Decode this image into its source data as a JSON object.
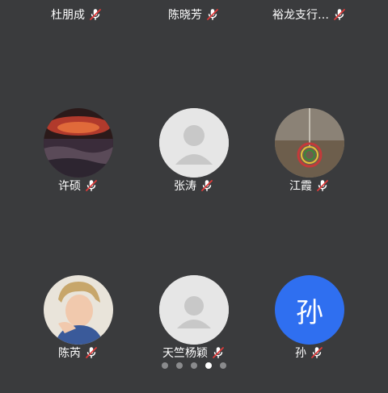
{
  "participants": [
    {
      "name": "杜朋成",
      "avatar_type": "blue-partial",
      "mic": "muted-mic-icon"
    },
    {
      "name": "陈晓芳",
      "avatar_type": "blue-partial",
      "mic": "muted-mic-icon"
    },
    {
      "name": "裕龙支行…",
      "avatar_type": "photo-partial",
      "mic": "muted-mic-icon"
    },
    {
      "name": "许硕",
      "avatar_type": "photo-galaxy",
      "mic": "muted-mic-icon"
    },
    {
      "name": "张涛",
      "avatar_type": "default-person",
      "mic": "muted-mic-icon"
    },
    {
      "name": "江霞",
      "avatar_type": "photo-ornament",
      "mic": "muted-mic-icon"
    },
    {
      "name": "陈芮",
      "avatar_type": "photo-person",
      "mic": "muted-mic-icon"
    },
    {
      "name": "天竺杨颖",
      "avatar_type": "default-person",
      "mic": "muted-mic-icon"
    },
    {
      "name": "孙",
      "avatar_type": "initial",
      "initial": "孙",
      "mic": "muted-mic-icon"
    }
  ],
  "pagination": {
    "total": 5,
    "active_index": 3
  },
  "colors": {
    "background": "#3a3b3d",
    "accent_blue": "#2f6ff0",
    "mute_red": "#e03a3a"
  }
}
